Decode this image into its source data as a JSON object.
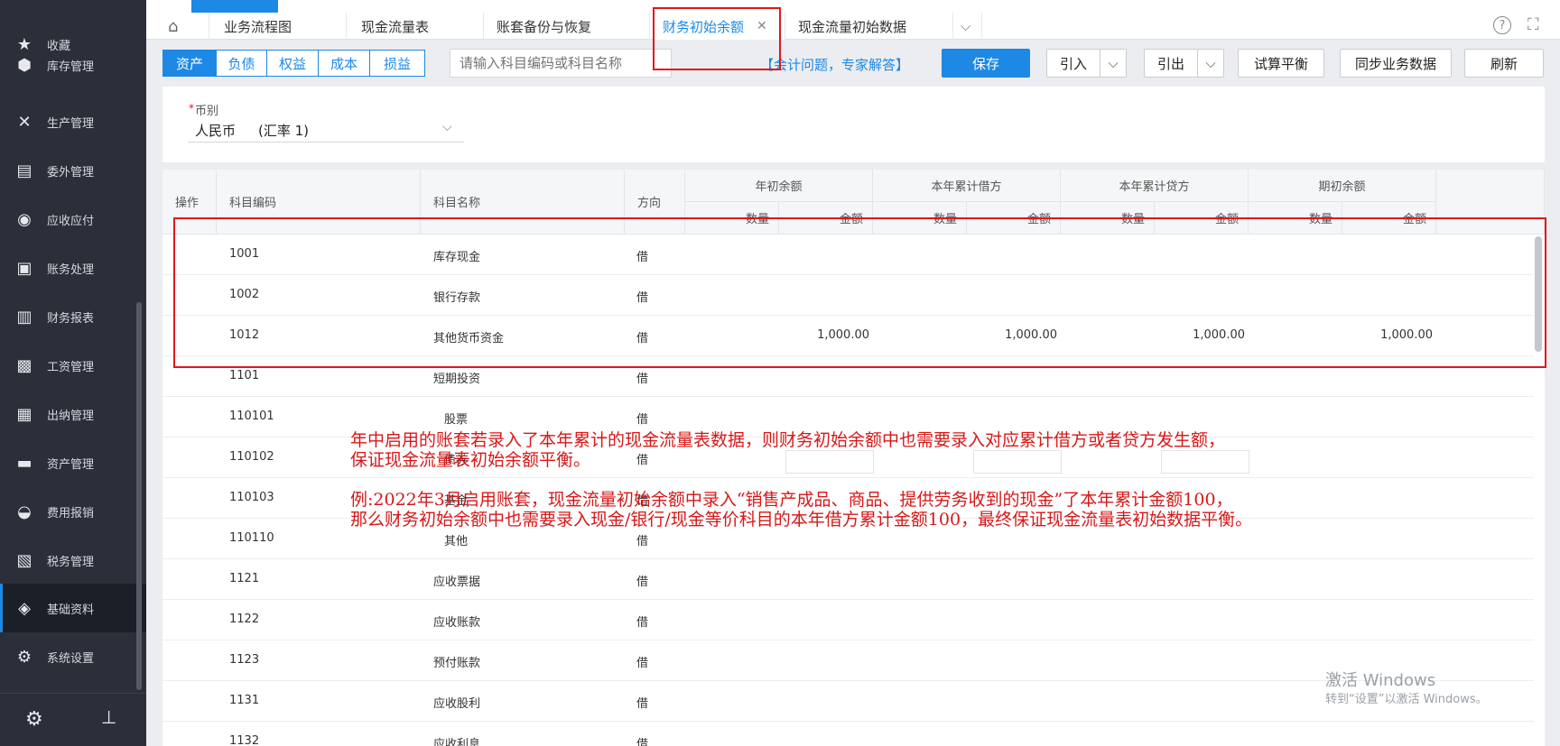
{
  "sidebar": {
    "items": [
      {
        "label": "收藏",
        "icon": "star-icon"
      },
      {
        "label": "库存管理",
        "icon": "cube-icon"
      },
      {
        "label": "生产管理",
        "icon": "tools-icon"
      },
      {
        "label": "委外管理",
        "icon": "document-icon"
      },
      {
        "label": "应收应付",
        "icon": "coin-icon"
      },
      {
        "label": "账务处理",
        "icon": "ledger-icon"
      },
      {
        "label": "财务报表",
        "icon": "report-icon"
      },
      {
        "label": "工资管理",
        "icon": "salary-icon"
      },
      {
        "label": "出纳管理",
        "icon": "cashier-icon"
      },
      {
        "label": "资产管理",
        "icon": "asset-icon"
      },
      {
        "label": "费用报销",
        "icon": "reimburse-icon"
      },
      {
        "label": "税务管理",
        "icon": "tax-icon"
      },
      {
        "label": "基础资料",
        "icon": "layers-icon"
      },
      {
        "label": "系统设置",
        "icon": "gear-icon"
      }
    ],
    "active_index": 12,
    "footer": {
      "settings_icon": "gear-icon",
      "pin_icon": "pin-icon"
    }
  },
  "tabs": [
    {
      "label": "业务流程图"
    },
    {
      "label": "现金流量表"
    },
    {
      "label": "账套备份与恢复"
    },
    {
      "label": "财务初始余额",
      "active": true,
      "closable": true
    },
    {
      "label": "现金流量初始数据"
    }
  ],
  "toolbar": {
    "categories": [
      "资产",
      "负债",
      "权益",
      "成本",
      "损益"
    ],
    "active_category": "资产",
    "search_placeholder": "请输入科目编码或科目名称",
    "help_link": "【会计问题，专家解答】",
    "save": "保存",
    "import": "引入",
    "export": "引出",
    "trial_balance": "试算平衡",
    "sync": "同步业务数据",
    "refresh": "刷新"
  },
  "currency": {
    "label": "币别",
    "required_mark": "*",
    "value": "人民币",
    "rate": "(汇率 1)"
  },
  "table": {
    "headers": {
      "op": "操作",
      "code": "科目编码",
      "name": "科目名称",
      "dir": "方向",
      "groups": [
        "年初余额",
        "本年累计借方",
        "本年累计贷方",
        "期初余额"
      ],
      "qty": "数量",
      "amt": "金额"
    },
    "rows": [
      {
        "code": "1001",
        "name": "库存现金",
        "dir": "借",
        "amounts": [
          "",
          "",
          "",
          ""
        ]
      },
      {
        "code": "1002",
        "name": "银行存款",
        "dir": "借",
        "amounts": [
          "",
          "",
          "",
          ""
        ]
      },
      {
        "code": "1012",
        "name": "其他货币资金",
        "dir": "借",
        "amounts": [
          "1,000.00",
          "1,000.00",
          "1,000.00",
          "1,000.00"
        ]
      },
      {
        "code": "1101",
        "name": "短期投资",
        "dir": "借",
        "amounts": [
          "",
          "",
          "",
          ""
        ]
      },
      {
        "code": "110101",
        "name": "股票",
        "dir": "借",
        "amounts": [
          "",
          "",
          "",
          ""
        ]
      },
      {
        "code": "110102",
        "name": "债券",
        "dir": "借",
        "amounts": [
          "",
          "",
          "",
          ""
        ]
      },
      {
        "code": "110103",
        "name": "基金",
        "dir": "借",
        "amounts": [
          "",
          "",
          "",
          ""
        ]
      },
      {
        "code": "110110",
        "name": "其他",
        "dir": "借",
        "amounts": [
          "",
          "",
          "",
          ""
        ]
      },
      {
        "code": "1121",
        "name": "应收票据",
        "dir": "借",
        "amounts": [
          "",
          "",
          "",
          ""
        ]
      },
      {
        "code": "1122",
        "name": "应收账款",
        "dir": "借",
        "amounts": [
          "",
          "",
          "",
          ""
        ]
      },
      {
        "code": "1123",
        "name": "预付账款",
        "dir": "借",
        "amounts": [
          "",
          "",
          "",
          ""
        ]
      },
      {
        "code": "1131",
        "name": "应收股利",
        "dir": "借",
        "amounts": [
          "",
          "",
          "",
          ""
        ]
      },
      {
        "code": "1132",
        "name": "应收利息",
        "dir": "借",
        "amounts": [
          "",
          "",
          "",
          ""
        ]
      }
    ]
  },
  "annotation": {
    "line1": "年中启用的账套若录入了本年累计的现金流量表数据，则财务初始余额中也需要录入对应累计借方或者贷方发生额，",
    "line2": "保证现金流量表初始余额平衡。",
    "line3": "例:2022年3月启用账套，现金流量初始余额中录入“销售产成品、商品、提供劳务收到的现金”了本年累计金额100，",
    "line4": "那么财务初始余额中也需要录入现金/银行/现金等价科目的本年借方累计金额100，最终保证现金流量表初始数据平衡。"
  },
  "watermark": {
    "line1": "激活 Windows",
    "line2": "转到“设置”以激活 Windows。"
  },
  "colors": {
    "accent": "#1e88e5",
    "sidebar": "#2b2f3a",
    "annotation": "#d71818"
  }
}
